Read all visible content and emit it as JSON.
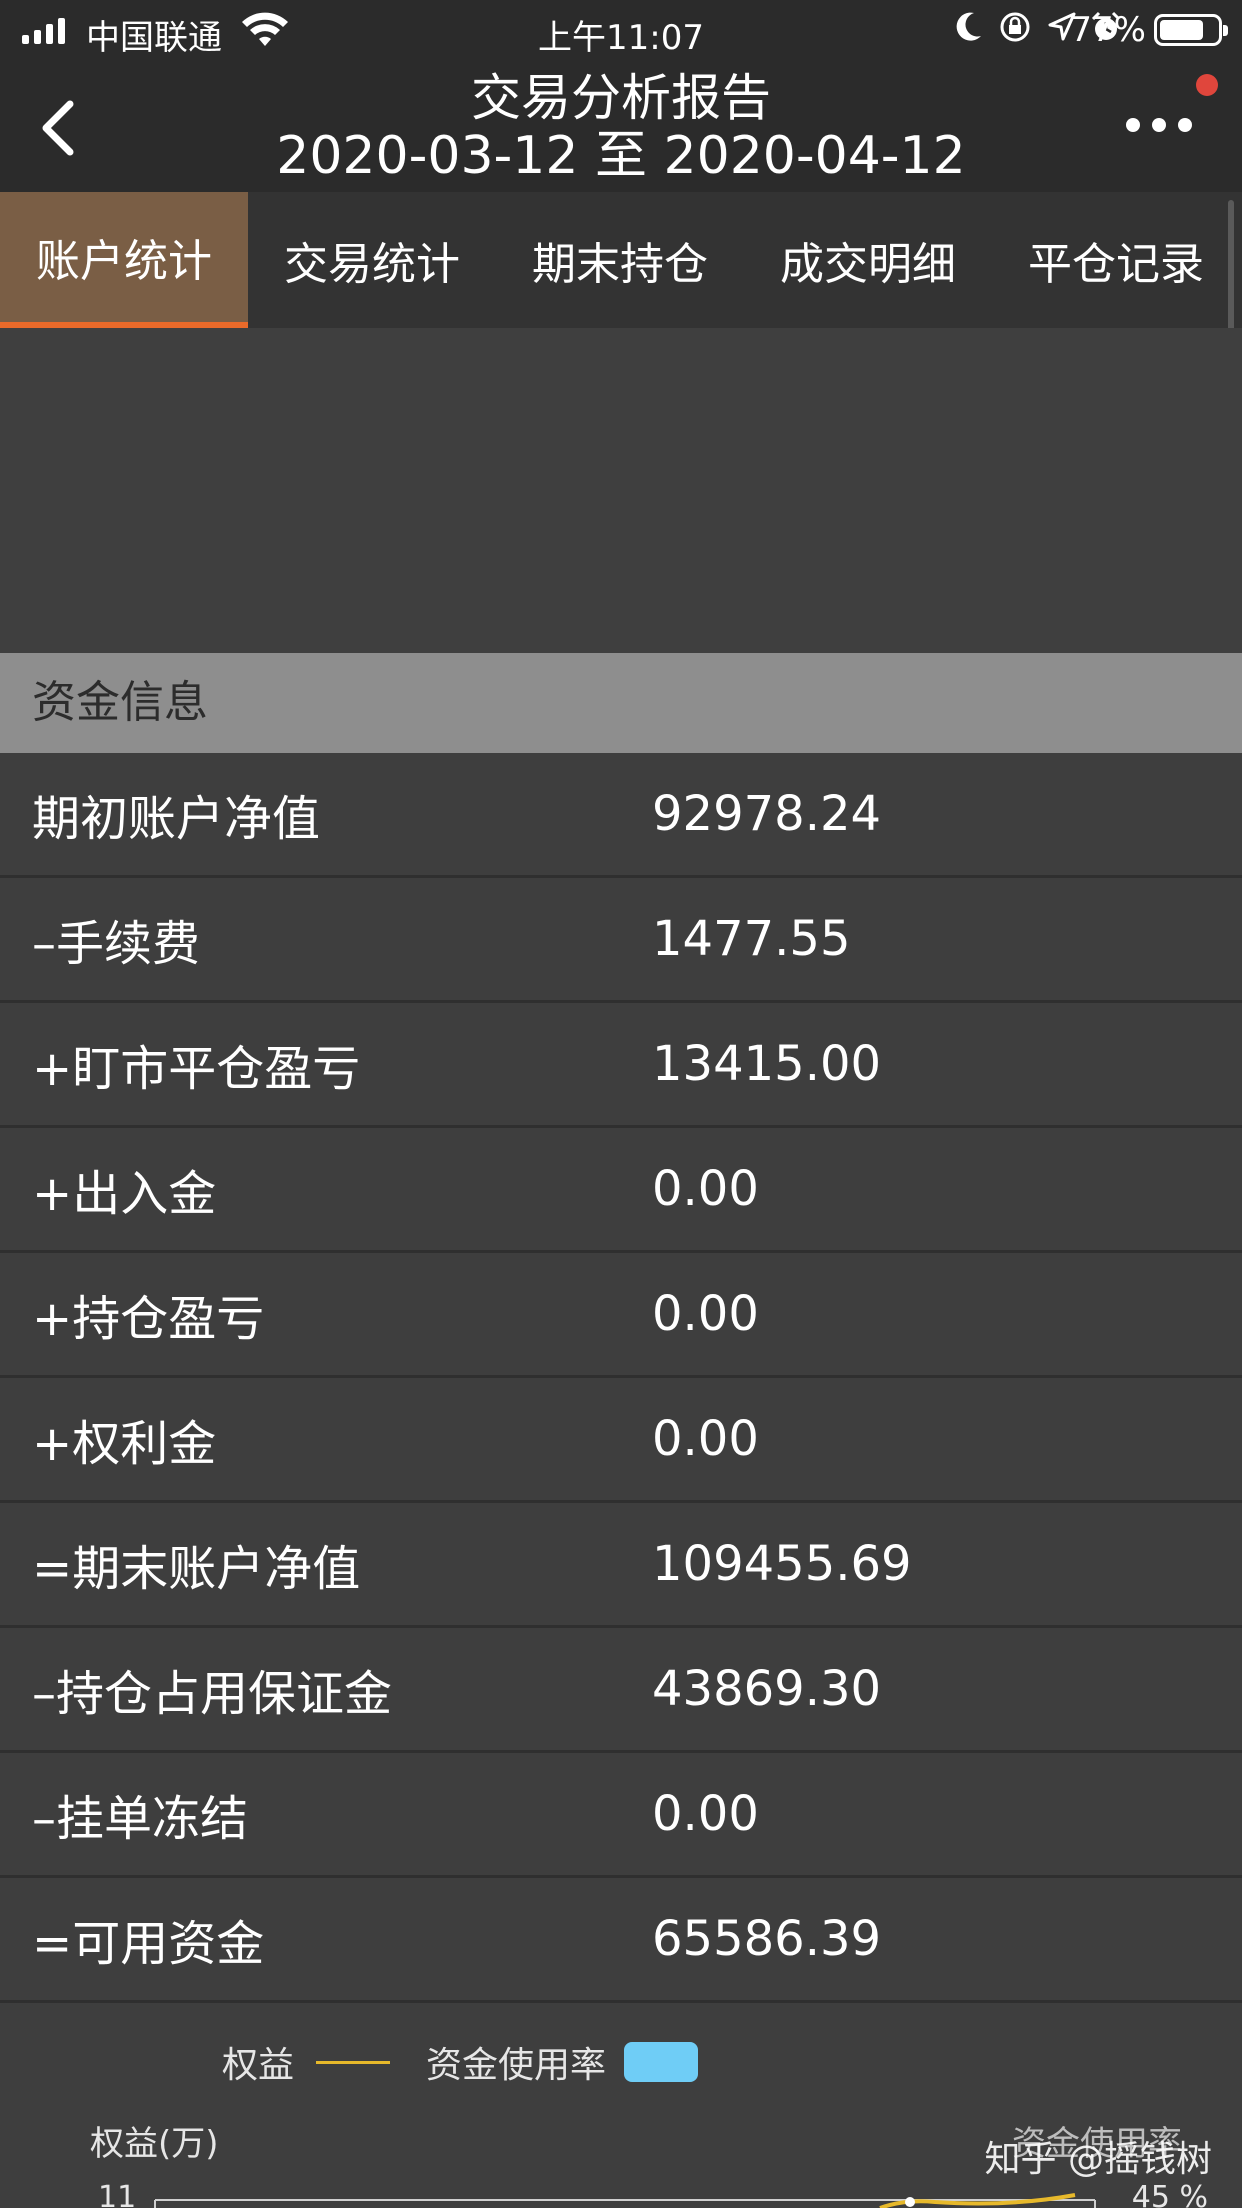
{
  "status_bar": {
    "carrier": "中国联通",
    "time": "上午11:07",
    "battery_percent": "77%",
    "battery_level": 0.77,
    "icons": [
      "signal-icon",
      "wifi-icon",
      "moon-icon",
      "rotation-lock-icon",
      "location-icon",
      "alarm-icon",
      "battery-icon"
    ]
  },
  "header": {
    "title": "交易分析报告",
    "date_range": "2020-03-12 至 2020-04-12",
    "back_icon": "back-chevron-icon",
    "more_icon": "more-dots-icon",
    "notification_color": "#e0463c"
  },
  "tabs": [
    {
      "label": "账户统计",
      "active": true
    },
    {
      "label": "交易统计",
      "active": false
    },
    {
      "label": "期末持仓",
      "active": false
    },
    {
      "label": "成交明细",
      "active": false
    },
    {
      "label": "平仓记录",
      "active": false
    }
  ],
  "section": {
    "title": "资金信息"
  },
  "rows": [
    {
      "label": "期初账户净值",
      "value": "92978.24"
    },
    {
      "label": "–手续费",
      "value": "1477.55"
    },
    {
      "label": "+盯市平仓盈亏",
      "value": "13415.00"
    },
    {
      "label": "+出入金",
      "value": "0.00"
    },
    {
      "label": "+持仓盈亏",
      "value": "0.00"
    },
    {
      "label": "+权利金",
      "value": "0.00"
    },
    {
      "label": "=期末账户净值",
      "value": "109455.69"
    },
    {
      "label": "–持仓占用保证金",
      "value": "43869.30"
    },
    {
      "label": "–挂单冻结",
      "value": "0.00"
    },
    {
      "label": "=可用资金",
      "value": "65586.39"
    }
  ],
  "chart": {
    "legend_equity": "权益",
    "legend_usage": "资金使用率",
    "left_axis_title": "权益(万)",
    "right_axis_title": "资金使用率",
    "left_tick_top": "11",
    "right_tick_top": "45 %",
    "equity_color": "#e7b92b",
    "usage_color": "#6fcdf6"
  },
  "watermark": "知乎 @摇钱树",
  "colors": {
    "accent": "#e96a2a",
    "active_tab_bg": "#7a5e45",
    "section_bg": "#8e8e8e"
  }
}
